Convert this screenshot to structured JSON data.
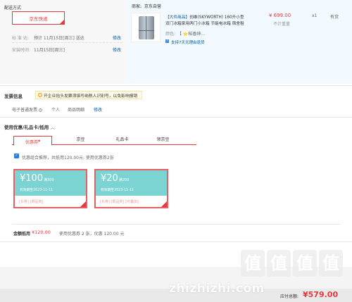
{
  "delivery": {
    "section_title": "配送方式",
    "express_button": "京东快递",
    "standard_label": "标 准 达:",
    "standard_value": "预计 11月15日[周三] 送达",
    "standard_edit": "修改",
    "install_label": "安装时间:",
    "install_value": "11月15日[周三]",
    "install_edit": "修改"
  },
  "product": {
    "seller_label": "商家:",
    "seller_name": "京东自营",
    "tag": "【大件商品】",
    "title_line1": "创维(SKYWORTH) 160升小型",
    "title_line2": "双门冰箱家用两门小冰箱 节能电冰箱 宿舍租",
    "color_label": "颜色:",
    "color_value": "【 ⭐稻香绅...",
    "return_badge": "7",
    "return_text": "支持7天无理由退货",
    "price": "¥ 699.00",
    "weight_note": "不计重量",
    "quantity": "x1",
    "stock": "有货"
  },
  "invoice": {
    "section_title": "发票信息",
    "tip_icon": "info-icon",
    "tip_text": "开企业抬头发票须填写纳税人识别号，以免影响报销",
    "type": "电子普通发票",
    "individual": "个人",
    "detail": "商品明细",
    "edit": "修改"
  },
  "coupons": {
    "section_title": "使用优惠/礼品卡/抵用",
    "tabs": [
      "优惠券",
      "京豆",
      "礼品卡",
      "领京豆"
    ],
    "tab_marker": "◆",
    "combo_text": "优惠组合推荐，共抵用120.00元: 使用优惠券2张",
    "items": [
      {
        "amount": "¥100",
        "condition": "满300",
        "validity": "有效期至2023-11-11",
        "tags": "[东券] [限品类]"
      },
      {
        "amount": "¥20",
        "condition": "满200",
        "validity": "有效期至2023-11-11",
        "tags": "[东券] [限品类] [可叠加]"
      }
    ],
    "summary_label": "金额抵用",
    "summary_amount": "¥120.00",
    "summary_detail": "使用优惠券 2 张，优惠 120.00 元"
  },
  "footer": {
    "total_label": "应付总额:",
    "total_amount": "¥579.00",
    "watermark_chars": [
      "值",
      "值",
      "值",
      "值"
    ],
    "watermark_text": "zhizhizhi.com"
  },
  "colors": {
    "accent": "#e4393c",
    "link": "#005ea7",
    "coupon_face": "#7bd4d2"
  }
}
